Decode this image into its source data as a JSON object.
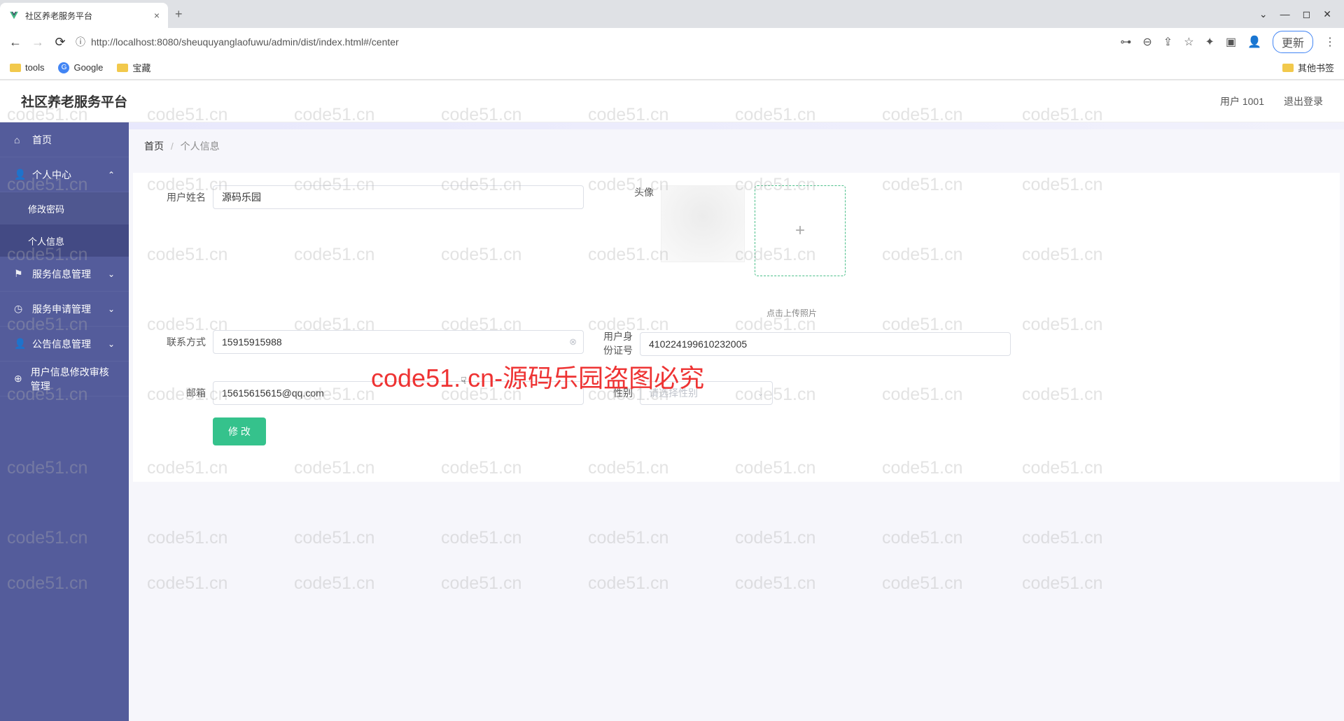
{
  "browser": {
    "tab_title": "社区养老服务平台",
    "url": "http://localhost:8080/sheuquyanglaofuwu/admin/dist/index.html#/center",
    "update_label": "更新",
    "bookmarks": {
      "tools": "tools",
      "google": "Google",
      "baozang": "宝藏",
      "others": "其他书签"
    }
  },
  "header": {
    "app_title": "社区养老服务平台",
    "user_label": "用户 1001",
    "logout": "退出登录"
  },
  "sidebar": {
    "home": "首页",
    "personal": "个人中心",
    "change_pw": "修改密码",
    "profile": "个人信息",
    "service_info": "服务信息管理",
    "service_apply": "服务申请管理",
    "notice": "公告信息管理",
    "user_audit": "用户信息修改审核管理"
  },
  "breadcrumb": {
    "home": "首页",
    "current": "个人信息"
  },
  "form": {
    "username_label": "用户姓名",
    "username_value": "源码乐园",
    "avatar_label": "头像",
    "upload_text": "点击上传照片",
    "contact_label": "联系方式",
    "contact_value": "15915915988",
    "idcard_label": "用户身份证号",
    "idcard_value": "410224199610232005",
    "email_label": "邮箱",
    "email_value": "15615615615@qq.com",
    "gender_label": "性别",
    "gender_placeholder": "请选择性别",
    "submit": "修 改"
  },
  "watermark": {
    "small": "code51.cn",
    "big": "code51. cn-源码乐园盗图必究"
  }
}
